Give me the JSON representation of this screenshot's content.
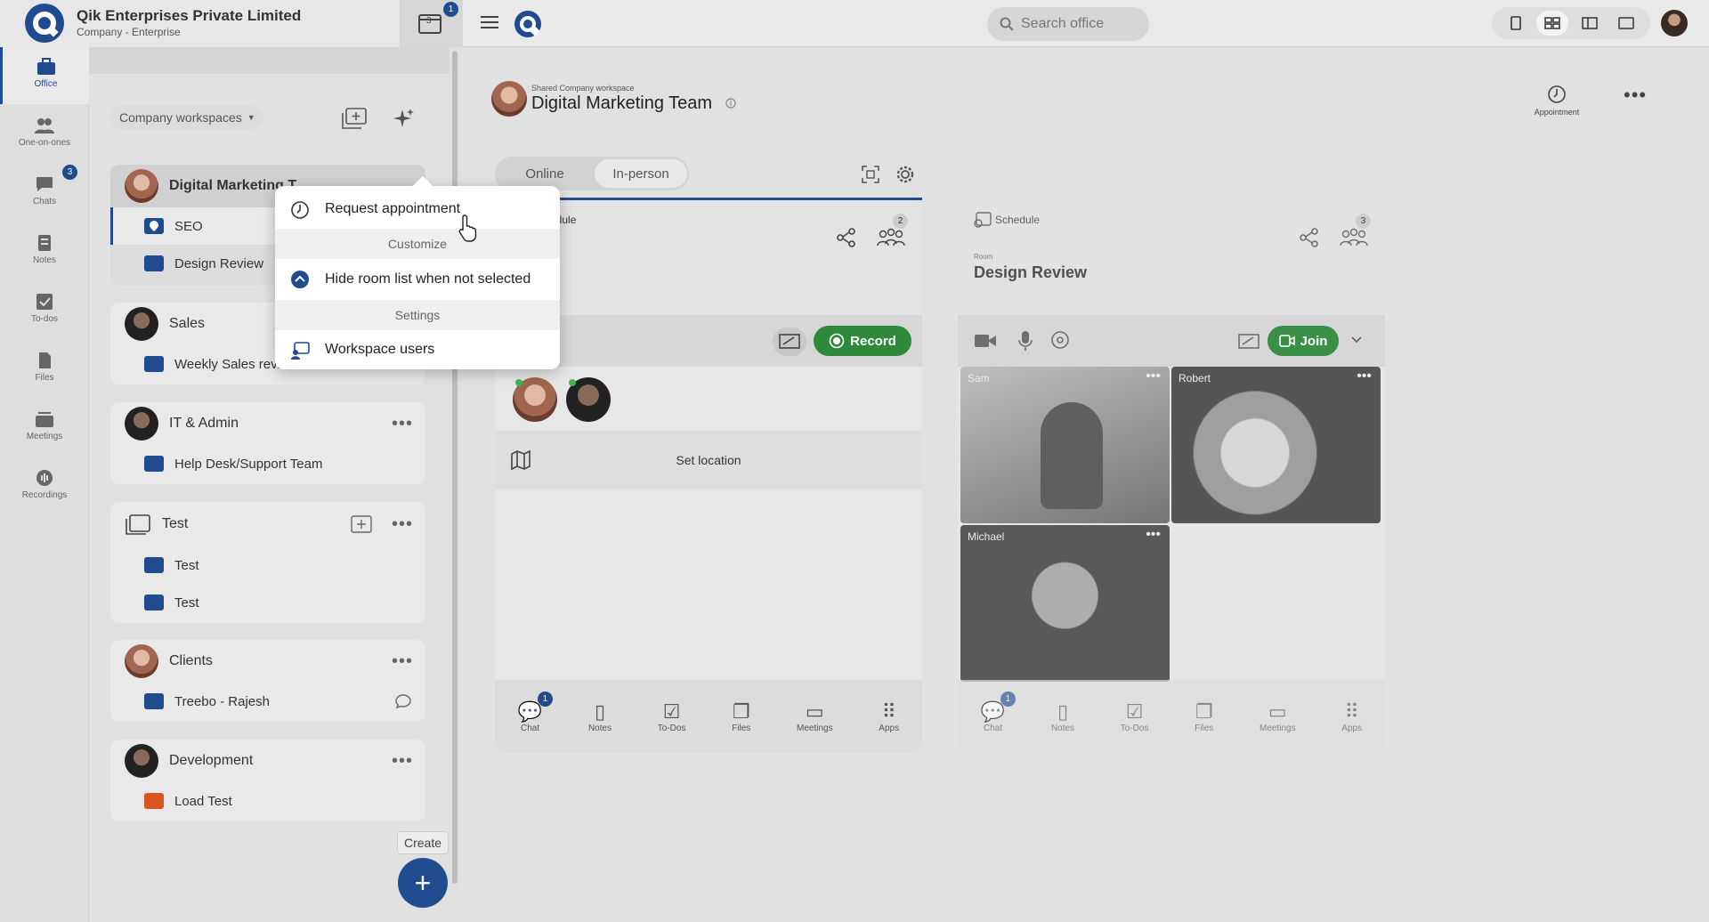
{
  "company": {
    "name": "Qik Enterprises Private Limited",
    "type": "Company - Enterprise"
  },
  "topbar": {
    "calendar_day": "3",
    "calendar_badge": "1",
    "search_placeholder": "Search office"
  },
  "rail": [
    {
      "label": "Office",
      "icon": "briefcase-icon"
    },
    {
      "label": "One-on-ones",
      "icon": "people-icon"
    },
    {
      "label": "Chats",
      "icon": "chat-icon",
      "badge": "3"
    },
    {
      "label": "Notes",
      "icon": "notes-icon"
    },
    {
      "label": "To-dos",
      "icon": "todo-icon"
    },
    {
      "label": "Files",
      "icon": "files-icon"
    },
    {
      "label": "Meetings",
      "icon": "meetings-icon"
    },
    {
      "label": "Recordings",
      "icon": "recordings-icon"
    }
  ],
  "panel": {
    "selector": "Company workspaces",
    "groups": [
      {
        "name": "Digital Marketing T...",
        "rooms": [
          "SEO",
          "Design Review"
        ]
      },
      {
        "name": "Sales",
        "rooms": [
          "Weekly Sales review"
        ]
      },
      {
        "name": "IT & Admin",
        "rooms": [
          "Help Desk/Support Team"
        ]
      },
      {
        "name": "Test",
        "rooms": [
          "Test",
          "Test"
        ]
      },
      {
        "name": "Clients",
        "rooms": [
          "Treebo - Rajesh"
        ]
      },
      {
        "name": "Development",
        "rooms": [
          "Load Test"
        ]
      }
    ],
    "create_tooltip": "Create",
    "fab": "+"
  },
  "popup": {
    "request": "Request appointment",
    "customize": "Customize",
    "hide_rooms": "Hide room list when not selected",
    "settings": "Settings",
    "workspace_users": "Workspace users"
  },
  "header": {
    "subtitle": "Shared Company workspace",
    "title": "Digital Marketing Team",
    "appointment": "Appointment",
    "tab_online": "Online",
    "tab_inperson": "In-person"
  },
  "card1": {
    "schedule": "edule",
    "participants": "2",
    "record": "Record",
    "set_location": "Set location"
  },
  "card2": {
    "schedule": "Schedule",
    "room_label": "Room",
    "room_name": "Design Review",
    "participants": "3",
    "join": "Join",
    "tiles": [
      "Sam",
      "Robert",
      "Michael"
    ]
  },
  "footer_items": [
    "Chat",
    "Notes",
    "To-Dos",
    "Files",
    "Meetings",
    "Apps"
  ],
  "footer_chat_badge": "1"
}
